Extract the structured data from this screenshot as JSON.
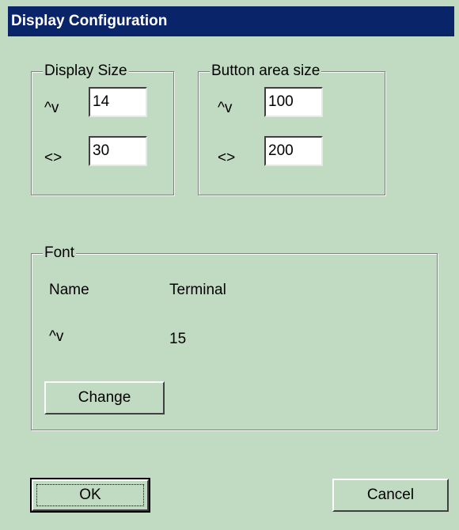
{
  "window": {
    "title": "Display Configuration"
  },
  "display_size": {
    "legend": "Display Size",
    "vertical_label": "^v",
    "vertical_value": "14",
    "horizontal_label": "<>",
    "horizontal_value": "30"
  },
  "button_area": {
    "legend": "Button area size",
    "vertical_label": "^v",
    "vertical_value": "100",
    "horizontal_label": "<>",
    "horizontal_value": "200"
  },
  "font": {
    "legend": "Font",
    "name_label": "Name",
    "name_value": "Terminal",
    "size_label": "^v",
    "size_value": "15",
    "change_label": "Change"
  },
  "buttons": {
    "ok_label": "OK",
    "cancel_label": "Cancel"
  },
  "colors": {
    "background": "#c1dbc3",
    "titlebar": "#0a246a",
    "titlebar_text": "#ffffff"
  }
}
